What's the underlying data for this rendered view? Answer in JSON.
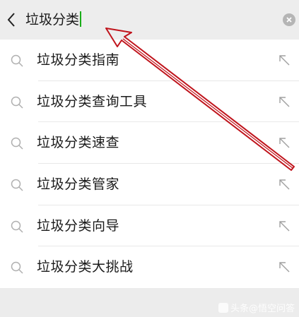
{
  "search": {
    "query": "垃圾分类"
  },
  "suggestions": [
    {
      "label": "垃圾分类指南"
    },
    {
      "label": "垃圾分类查询工具"
    },
    {
      "label": "垃圾分类速查"
    },
    {
      "label": "垃圾分类管家"
    },
    {
      "label": "垃圾分类向导"
    },
    {
      "label": "垃圾分类大挑战"
    }
  ],
  "watermark": {
    "text": "头条@悟空问答"
  },
  "colors": {
    "annotation_arrow": "#c0141c",
    "caret": "#1aad19"
  },
  "icons": {
    "back": "chevron-left-icon",
    "clear": "clear-icon",
    "suggestion": "search-icon",
    "fill": "arrow-up-left-icon"
  }
}
